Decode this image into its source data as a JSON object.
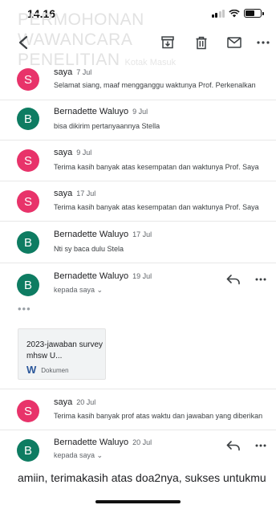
{
  "status_bar": {
    "time": "14.16"
  },
  "header": {
    "subject": "PERMOHONAN WAWANCARA PENELITIAN",
    "label": "Kotak Masuk"
  },
  "toolbar": {
    "back_icon": "arrow-back-icon",
    "archive_icon": "archive-icon",
    "delete_icon": "trash-icon",
    "unread_icon": "mail-icon",
    "more_icon": "more-horizontal-icon"
  },
  "colors": {
    "avatar_s": "#e8336a",
    "avatar_b": "#0e7c62",
    "attachment_word": "#2b579a"
  },
  "messages": [
    {
      "initial": "S",
      "sender": "saya",
      "date": "7 Jul",
      "snippet": "Selamat siang, maaf mengganggu waktunya Prof. Perkenalkan"
    },
    {
      "initial": "B",
      "sender": "Bernadette Waluyo",
      "date": "9 Jul",
      "snippet": "bisa dikirim pertanyaannya Stella"
    },
    {
      "initial": "S",
      "sender": "saya",
      "date": "9 Jul",
      "snippet": "Terima kasih banyak atas kesempatan dan waktunya Prof. Saya"
    },
    {
      "initial": "S",
      "sender": "saya",
      "date": "17 Jul",
      "snippet": "Terima kasih banyak atas kesempatan dan waktunya Prof. Saya"
    },
    {
      "initial": "B",
      "sender": "Bernadette Waluyo",
      "date": "17 Jul",
      "snippet": "Nti sy baca dulu Stela"
    },
    {
      "initial": "B",
      "sender": "Bernadette Waluyo",
      "date": "19 Jul",
      "recipient": "kepada saya ⌄",
      "quoted_toggle": "•••"
    },
    {
      "initial": "S",
      "sender": "saya",
      "date": "20 Jul",
      "snippet": "Terima kasih banyak prof atas waktu dan jawaban yang diberikan"
    },
    {
      "initial": "B",
      "sender": "Bernadette Waluyo",
      "date": "20 Jul",
      "recipient": "kepada saya ⌄",
      "body": "amiin, terimakasih atas doa2nya, sukses untukmu"
    }
  ],
  "attachment": {
    "name": "2023-jawaban survey mhsw U...",
    "type_label": "Dokumen",
    "icon_letter": "W"
  }
}
